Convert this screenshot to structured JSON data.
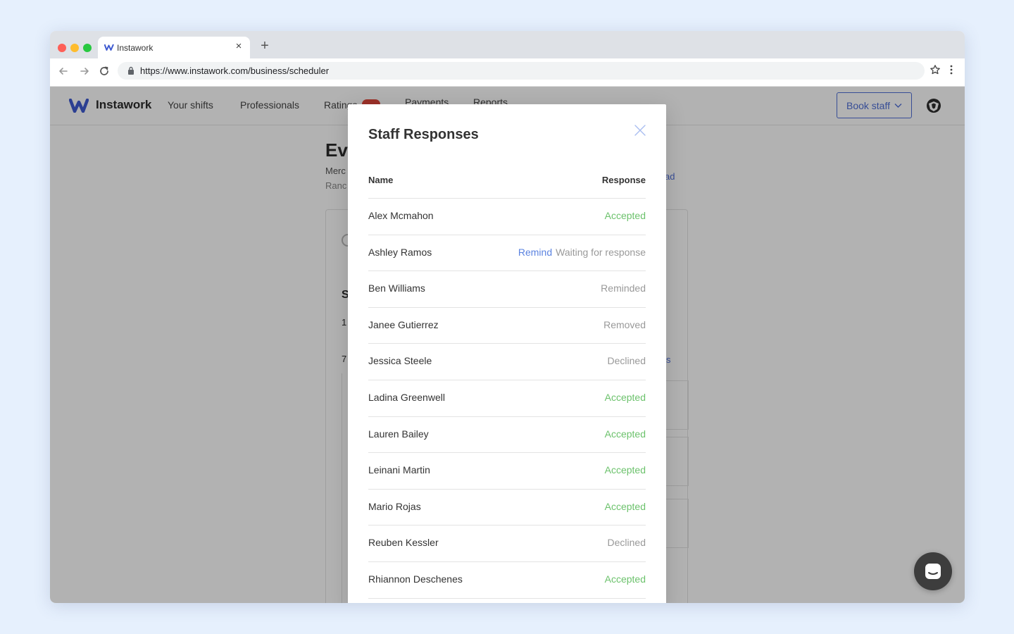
{
  "browser": {
    "tab_title": "Instawork",
    "new_tab_symbol": "+",
    "close_symbol": "×",
    "url": "https://www.instawork.com/business/scheduler"
  },
  "header": {
    "logo_text": "Instawork",
    "nav": [
      {
        "label": "Your shifts"
      },
      {
        "label": "Professionals"
      },
      {
        "label": "Ratings"
      },
      {
        "label": "Payments"
      },
      {
        "label": "Reports"
      }
    ],
    "book_staff_label": "Book staff"
  },
  "background": {
    "title_fragment": "Ev",
    "sub1_fragment": "Merc",
    "sub2_fragment": "Ranc",
    "download_fragment": "ad",
    "section_fragment": "S",
    "num1_fragment": "1",
    "num2_fragment": "7",
    "link_fragment": "s"
  },
  "modal": {
    "title": "Staff Responses",
    "columns": {
      "name": "Name",
      "response": "Response"
    },
    "rows": [
      {
        "name": "Alex Mcmahon",
        "action": "",
        "status": "Accepted",
        "status_type": "accepted"
      },
      {
        "name": "Ashley Ramos",
        "action": "Remind",
        "status": "Waiting for response",
        "status_type": "waiting"
      },
      {
        "name": "Ben Williams",
        "action": "",
        "status": "Reminded",
        "status_type": "reminded"
      },
      {
        "name": "Janee Gutierrez",
        "action": "",
        "status": "Removed",
        "status_type": "removed"
      },
      {
        "name": "Jessica Steele",
        "action": "",
        "status": "Declined",
        "status_type": "declined"
      },
      {
        "name": "Ladina Greenwell",
        "action": "",
        "status": "Accepted",
        "status_type": "accepted"
      },
      {
        "name": "Lauren Bailey",
        "action": "",
        "status": "Accepted",
        "status_type": "accepted"
      },
      {
        "name": "Leinani Martin",
        "action": "",
        "status": "Accepted",
        "status_type": "accepted"
      },
      {
        "name": "Mario Rojas",
        "action": "",
        "status": "Accepted",
        "status_type": "accepted"
      },
      {
        "name": "Reuben Kessler",
        "action": "",
        "status": "Declined",
        "status_type": "declined"
      },
      {
        "name": "Rhiannon Deschenes",
        "action": "",
        "status": "Accepted",
        "status_type": "accepted"
      }
    ]
  },
  "colors": {
    "accent": "#4f6fd7",
    "accepted": "#6cc26c",
    "muted": "#999999",
    "remind_link": "#5b83e0",
    "page_background": "#e6f0fd"
  },
  "icons": {
    "back": "arrow-left-icon",
    "forward": "arrow-right-icon",
    "reload": "reload-icon",
    "lock": "lock-icon",
    "bookmark": "star-icon",
    "menu": "kebab-menu-icon",
    "close": "close-icon",
    "chat": "chat-icon"
  }
}
